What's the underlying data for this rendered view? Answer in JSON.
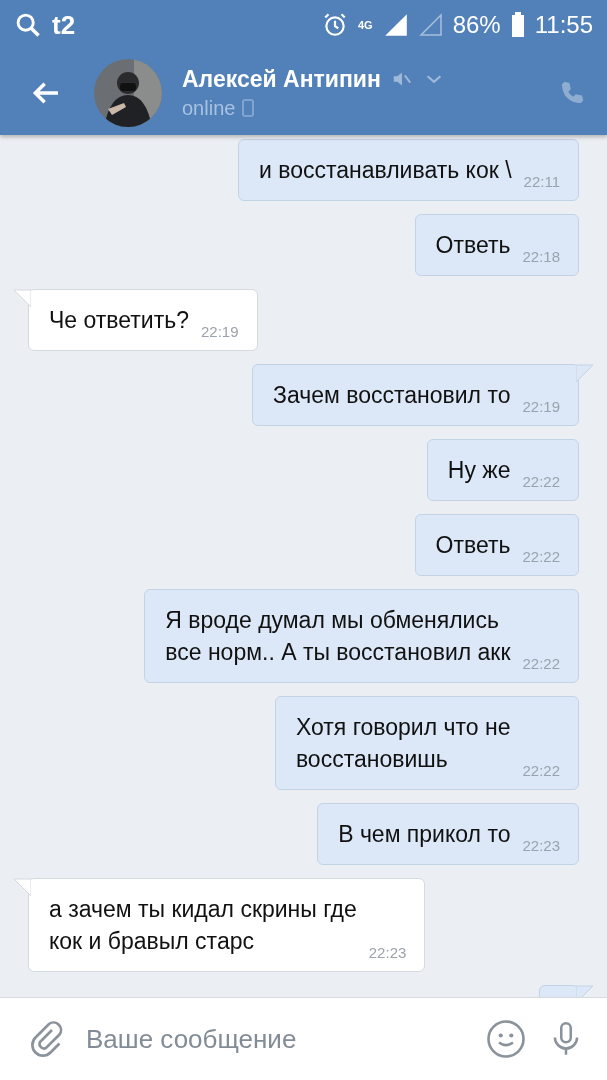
{
  "status_bar": {
    "carrier": "t2",
    "network": "4G",
    "battery": "86%",
    "time": "11:55"
  },
  "header": {
    "name": "Алексей Антипин",
    "presence": "online",
    "muted": true
  },
  "messages": [
    {
      "from_me": true,
      "tail": false,
      "text": "и восстанавливать кок \\",
      "time": "22:11"
    },
    {
      "from_me": true,
      "tail": false,
      "text": "Ответь",
      "time": "22:18"
    },
    {
      "from_me": false,
      "tail": true,
      "text": "Че ответить?",
      "time": "22:19"
    },
    {
      "from_me": true,
      "tail": true,
      "text": "Зачем восстановил то",
      "time": "22:19"
    },
    {
      "from_me": true,
      "tail": false,
      "text": "Ну же",
      "time": "22:22"
    },
    {
      "from_me": true,
      "tail": false,
      "text": "Ответь",
      "time": "22:22"
    },
    {
      "from_me": true,
      "tail": false,
      "text": "Я вроде думал мы обменялись\nвсе норм.. А ты восстановил акк",
      "time": "22:22"
    },
    {
      "from_me": true,
      "tail": false,
      "text": "Хотя говорил что не\nвосстановишь",
      "time": "22:22"
    },
    {
      "from_me": true,
      "tail": false,
      "text": "В чем прикол то",
      "time": "22:23"
    },
    {
      "from_me": false,
      "tail": true,
      "text": "а зачем ты кидал скрины где\nкок и бравыл старс",
      "time": "22:23"
    },
    {
      "from_me": true,
      "tail": true
    }
  ],
  "composer": {
    "placeholder": "Ваше сообщение"
  }
}
